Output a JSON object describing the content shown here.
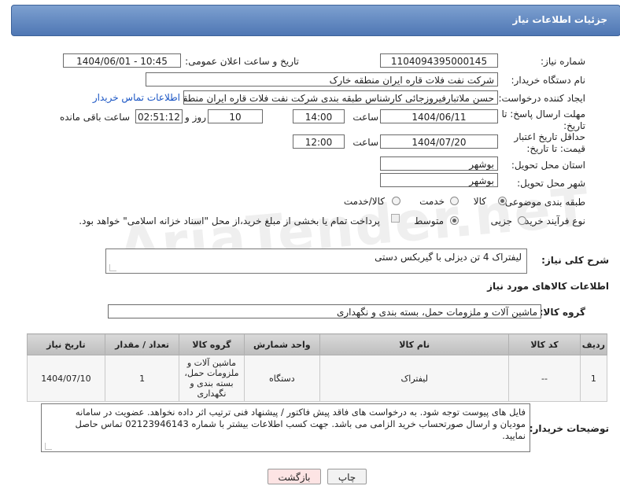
{
  "header": {
    "title": "جزئیات اطلاعات نیاز"
  },
  "watermark": "AriaTender.neT",
  "fields": {
    "need_number_label": "شماره نیاز:",
    "need_number": "1104094395000145",
    "announce_label": "تاریخ و ساعت اعلان عمومی:",
    "announce_value": "1404/06/01 - 10:45",
    "buyer_org_label": "نام دستگاه خریدار:",
    "buyer_org": "شرکت نفت فلات قاره ایران منطقه خارک",
    "creator_label": "ایجاد کننده درخواست:",
    "creator": "حسن ملاتبارفیروزجائی کارشناس طبقه بندی  شرکت نفت فلات قاره ایران منطقه",
    "buyer_contact_link": "اطلاعات تماس خریدار",
    "reply_deadline_label": "مهلت ارسال پاسخ: تا تاریخ:",
    "reply_date": "1404/06/11",
    "time_label": "ساعت",
    "reply_time": "14:00",
    "days_value": "10",
    "days_label": "روز و",
    "remaining_time": "02:51:12",
    "remaining_label": "ساعت باقی مانده",
    "price_deadline_label": "حداقل تاریخ اعتبار قیمت: تا تاریخ:",
    "price_date": "1404/07/20",
    "price_time": "12:00",
    "province_label": "استان محل تحویل:",
    "province": "بوشهر",
    "city_label": "شهر محل تحویل:",
    "city": "بوشهر",
    "category_label": "طبقه بندی موضوعی:",
    "category_options": [
      "کالا",
      "خدمت",
      "کالا/خدمت"
    ],
    "purchase_type_label": "نوع فرآیند خرید :",
    "purchase_options": [
      "جزیی",
      "متوسط"
    ],
    "payment_note": "پرداخت تمام یا بخشی از مبلغ خرید،از محل \"اسناد خزانه اسلامی\" خواهد بود."
  },
  "description": {
    "label": "شرح کلی نیاز:",
    "text": "لیفتراک 4 تن دیزلی با گیربکس دستی"
  },
  "goods_info": {
    "title": "اطلاعات کالاهای مورد نیاز",
    "group_label": "گروه کالا:",
    "group_value": "ماشین آلات و ملزومات حمل، بسته بندی و نگهداری"
  },
  "table": {
    "headers": [
      "ردیف",
      "کد کالا",
      "نام کالا",
      "واحد شمارش",
      "گروه کالا",
      "تعداد / مقدار",
      "تاریخ نیاز"
    ],
    "rows": [
      {
        "row": "1",
        "code": "--",
        "name": "لیفتراک",
        "unit": "دستگاه",
        "group": "ماشین آلات و ملزومات حمل، بسته بندی و نگهداری",
        "qty": "1",
        "date": "1404/07/10"
      }
    ]
  },
  "buyer_notes": {
    "label": "توضیحات خریدار:",
    "text": "فایل های پیوست توجه شود. به درخواست های فاقد پیش فاکتور / پیشنهاد فنی ترتیب اثر داده نخواهد. عضویت در سامانه مودیان و ارسال صورتحساب خرید الزامی می باشد. جهت کسب اطلاعات بیشتر با شماره 02123946143 تماس حاصل نمایید."
  },
  "buttons": {
    "print": "چاپ",
    "back": "بازگشت"
  }
}
